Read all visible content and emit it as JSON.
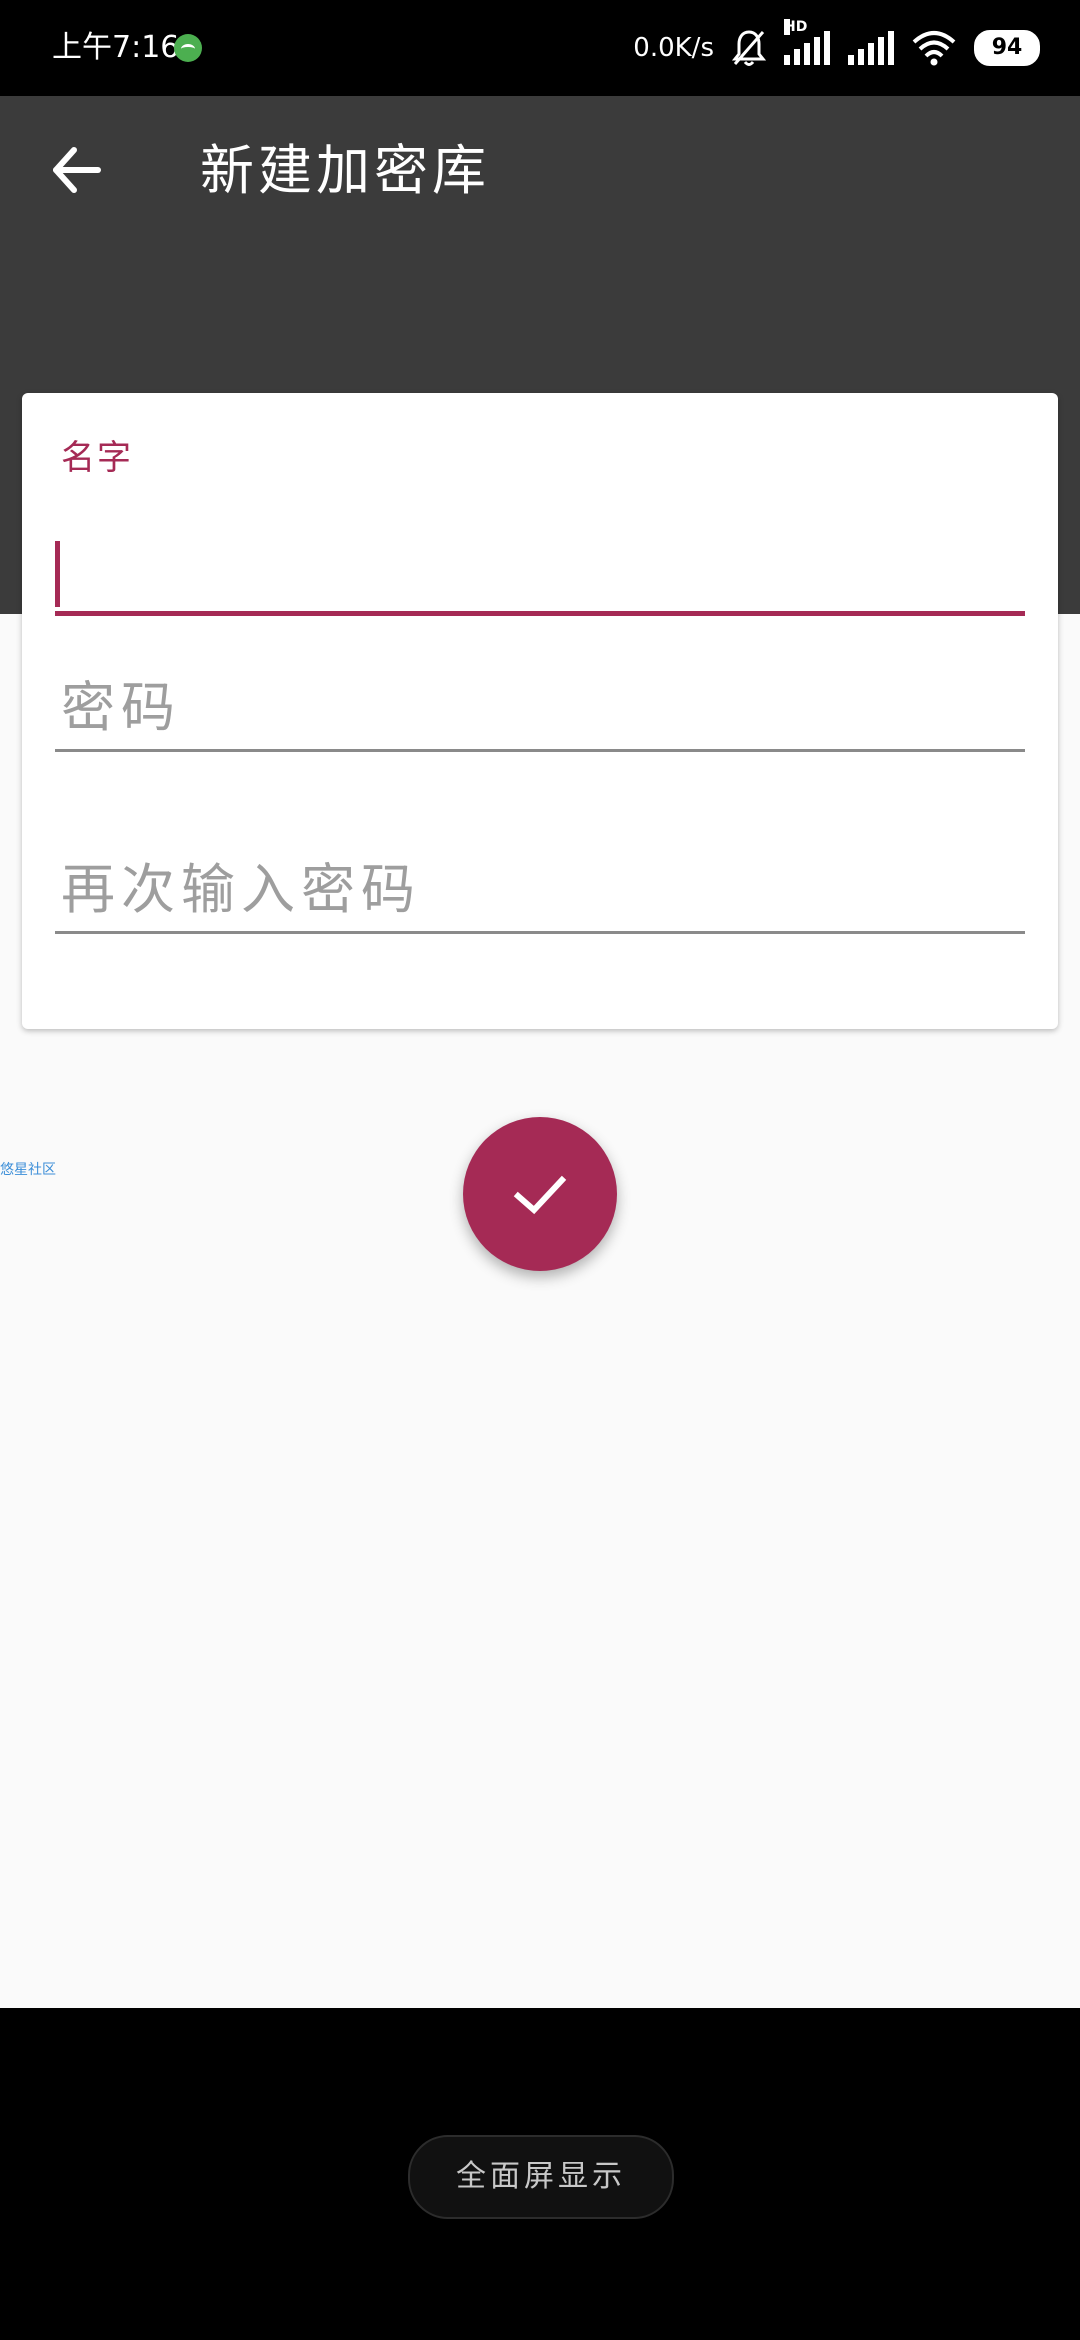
{
  "status_bar": {
    "time": "上午7:16",
    "net_speed": "0.0K/s",
    "hd_label": "HD",
    "battery": "94"
  },
  "app_bar": {
    "title": "新建加密库"
  },
  "form": {
    "name_label": "名字",
    "name_value": "",
    "password_placeholder": "密码",
    "confirm_placeholder": "再次输入密码"
  },
  "watermark": "悠星社区",
  "nav": {
    "fullscreen_label": "全面屏显示"
  },
  "colors": {
    "accent": "#a52a55",
    "app_bar": "#3b3b3b"
  }
}
